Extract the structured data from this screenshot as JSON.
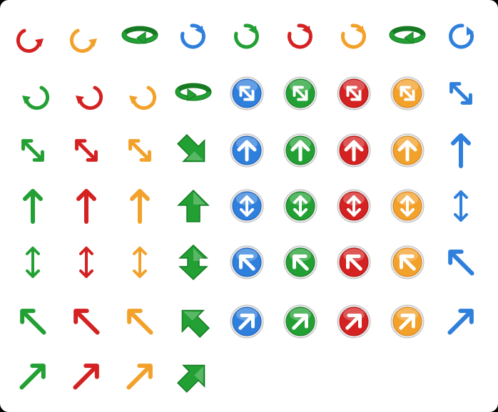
{
  "colors": {
    "red": "#d42121",
    "orange": "#f2a12a",
    "green": "#22a033",
    "blue": "#2f7fdc",
    "red_dark": "#b01818",
    "green_dark": "#157a22",
    "blue_dark": "#1f5fb5",
    "orange_dark": "#d9821a"
  },
  "rows": [
    [
      {
        "icon": "rotate-cw",
        "color": "red"
      },
      {
        "icon": "rotate-cw",
        "color": "orange"
      },
      {
        "icon": "rotate-3d",
        "color": "green"
      },
      {
        "icon": "rotate-cw-b",
        "color": "blue"
      },
      {
        "icon": "rotate-cw-b",
        "color": "green"
      },
      {
        "icon": "rotate-cw-b",
        "color": "red"
      },
      {
        "icon": "rotate-cw-b",
        "color": "orange"
      },
      {
        "icon": "rotate-3d",
        "color": "green"
      },
      {
        "icon": "rotate-ccw-b",
        "color": "blue"
      }
    ],
    [
      {
        "icon": "rotate-ccw",
        "color": "green"
      },
      {
        "icon": "rotate-ccw",
        "color": "red"
      },
      {
        "icon": "rotate-ccw",
        "color": "orange"
      },
      {
        "icon": "rotate-3d-ccw",
        "color": "green"
      },
      {
        "icon": "circle-diag",
        "color": "blue"
      },
      {
        "icon": "circle-diag",
        "color": "green"
      },
      {
        "icon": "circle-diag",
        "color": "red"
      },
      {
        "icon": "circle-diag",
        "color": "orange"
      },
      {
        "icon": "diag-double",
        "color": "blue"
      }
    ],
    [
      {
        "icon": "diag-double",
        "color": "green"
      },
      {
        "icon": "diag-double",
        "color": "red"
      },
      {
        "icon": "diag-double",
        "color": "orange"
      },
      {
        "icon": "block-diag",
        "color": "green"
      },
      {
        "icon": "circle-up",
        "color": "blue"
      },
      {
        "icon": "circle-up",
        "color": "green"
      },
      {
        "icon": "circle-up",
        "color": "red"
      },
      {
        "icon": "circle-up",
        "color": "orange"
      },
      {
        "icon": "arrow-up",
        "color": "blue"
      }
    ],
    [
      {
        "icon": "arrow-up",
        "color": "green"
      },
      {
        "icon": "arrow-up",
        "color": "red"
      },
      {
        "icon": "arrow-up",
        "color": "orange"
      },
      {
        "icon": "block-up",
        "color": "green"
      },
      {
        "icon": "circle-updown",
        "color": "blue"
      },
      {
        "icon": "circle-updown",
        "color": "green"
      },
      {
        "icon": "circle-updown",
        "color": "red"
      },
      {
        "icon": "circle-updown",
        "color": "orange"
      },
      {
        "icon": "arrow-updown",
        "color": "blue"
      }
    ],
    [
      {
        "icon": "arrow-updown",
        "color": "green"
      },
      {
        "icon": "arrow-updown",
        "color": "red"
      },
      {
        "icon": "arrow-updown",
        "color": "orange"
      },
      {
        "icon": "block-updown",
        "color": "green"
      },
      {
        "icon": "circle-upleft",
        "color": "blue"
      },
      {
        "icon": "circle-upleft",
        "color": "green"
      },
      {
        "icon": "circle-upleft",
        "color": "red"
      },
      {
        "icon": "circle-upleft",
        "color": "orange"
      },
      {
        "icon": "arrow-upleft",
        "color": "blue"
      }
    ],
    [
      {
        "icon": "arrow-upleft",
        "color": "green"
      },
      {
        "icon": "arrow-upleft",
        "color": "red"
      },
      {
        "icon": "arrow-upleft",
        "color": "orange"
      },
      {
        "icon": "block-upleft",
        "color": "green"
      },
      {
        "icon": "circle-upright",
        "color": "blue"
      },
      {
        "icon": "circle-upright",
        "color": "green"
      },
      {
        "icon": "circle-upright",
        "color": "red"
      },
      {
        "icon": "circle-upright",
        "color": "orange"
      },
      {
        "icon": "arrow-upright",
        "color": "blue"
      }
    ],
    [
      {
        "icon": "arrow-upright",
        "color": "green"
      },
      {
        "icon": "arrow-upright",
        "color": "red"
      },
      {
        "icon": "arrow-upright",
        "color": "orange"
      },
      {
        "icon": "block-upright",
        "color": "green"
      }
    ]
  ]
}
